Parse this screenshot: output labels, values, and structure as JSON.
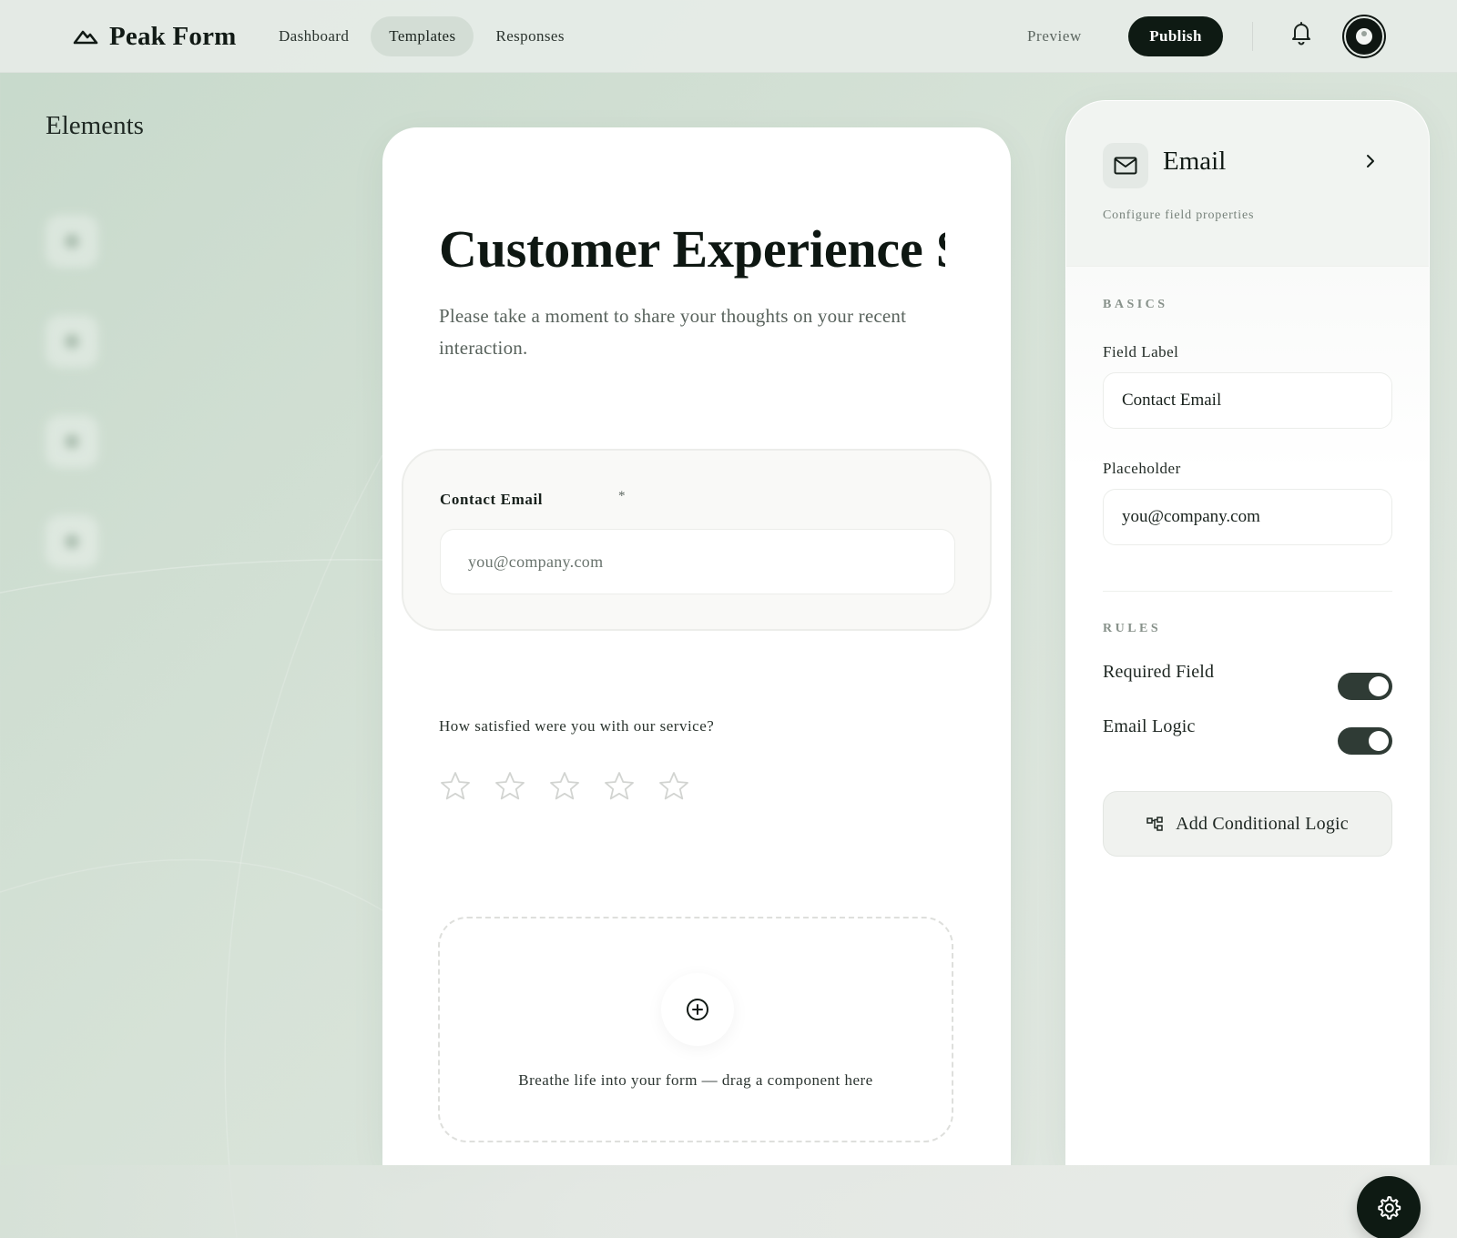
{
  "app": {
    "brand_name": "Peak Form",
    "brand_icon": "mountain-icon"
  },
  "nav": {
    "items": [
      {
        "label": "Dashboard",
        "active": false
      },
      {
        "label": "Templates",
        "active": true
      },
      {
        "label": "Responses",
        "active": false
      }
    ],
    "preview_label": "Preview",
    "publish_label": "Publish"
  },
  "sidebar": {
    "title": "Elements"
  },
  "form": {
    "title": "Customer Experience Survey",
    "description": "Please take a moment to share your thoughts on your recent interaction.",
    "email_field": {
      "label": "Contact Email",
      "required_mark": "*",
      "placeholder": "you@company.com"
    },
    "rating": {
      "question": "How satisfied were you with our service?",
      "stars_total": 5,
      "stars_selected": 0
    },
    "dropzone_text": "Breathe life into your form — drag a component here"
  },
  "panel": {
    "title": "Email",
    "subtitle": "Configure field properties",
    "basics_label": "BASICS",
    "field_label_label": "Field Label",
    "field_label_value": "Contact Email",
    "placeholder_label": "Placeholder",
    "placeholder_value": "you@company.com",
    "rules_label": "RULES",
    "rules": [
      {
        "label": "Required Field",
        "on": true
      },
      {
        "label": "Email Logic",
        "on": true
      }
    ],
    "logic_button_label": "Add Conditional Logic"
  },
  "colors": {
    "accent_dark": "#0e1a13",
    "toggle_on": "#2f3b35",
    "background": "#d6e2d7"
  }
}
